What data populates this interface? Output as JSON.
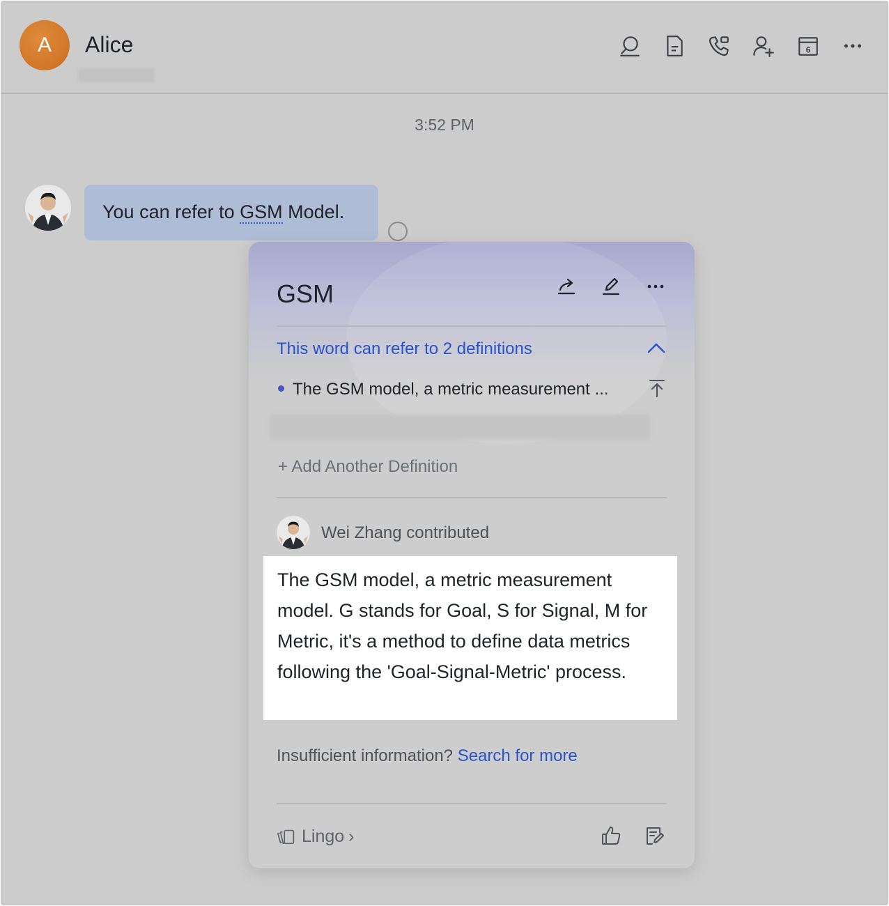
{
  "header": {
    "avatar_letter": "A",
    "chat_name": "Alice",
    "subtitle": "",
    "icons": [
      "search-icon",
      "document-icon",
      "phone-icon",
      "add-member-icon",
      "calendar-icon",
      "more-icon"
    ],
    "calendar_day": "6"
  },
  "chat": {
    "timestamp": "3:52 PM",
    "message": {
      "before": "You can refer to ",
      "term": "GSM",
      "after": " Model."
    }
  },
  "card": {
    "title": "GSM",
    "definition_count_text": "This word can refer to 2 definitions",
    "definitions": [
      {
        "text": "The GSM model, a metric measurement ..."
      }
    ],
    "add_definition": "+ Add Another Definition",
    "contributor_name": "Wei Zhang",
    "contributed_label": "contributed",
    "definition_text": "The GSM model, a metric measurement model. G stands for Goal, S for Signal, M for Metric, it's a method to define data metrics following the 'Goal-Signal-Metric' process.",
    "insufficient_text": "Insufficient information?",
    "search_link": "Search for more",
    "footer_label": "Lingo",
    "footer_chevron": "›"
  },
  "colors": {
    "accent": "#2952cc",
    "bubble": "#aebcd6",
    "avatar": "#d27a2a",
    "overlay_bg": "#cccccc"
  }
}
